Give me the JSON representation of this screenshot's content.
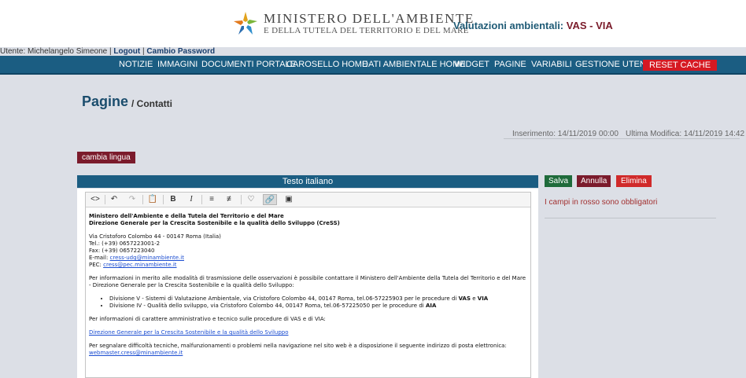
{
  "header": {
    "ministry_title": "MINISTERO DELL'AMBIENTE",
    "ministry_subtitle": "E DELLA TUTELA DEL TERRITORIO E DEL MARE",
    "site_title": "Valutazioni ambientali:",
    "site_title_accent": "VAS - VIA"
  },
  "userbar": {
    "user_text": "Utente: Michelangelo Simeone |",
    "logout": "Logout",
    "separator": "|",
    "change_password": "Cambio Password"
  },
  "nav": {
    "items": [
      "NOTIZIE",
      "IMMAGINI",
      "DOCUMENTI PORTALE",
      "CAROSELLO HOME",
      "DATI AMBIENTALE HOME",
      "WIDGET",
      "PAGINE",
      "VARIABILI",
      "GESTIONE UTENTI"
    ],
    "reset": "RESET CACHE"
  },
  "page": {
    "title": "Pagine",
    "crumb": "/ Contatti",
    "inserted": "Inserimento: 14/11/2019 00:00",
    "modified": "Ultima Modifica: 14/11/2019 14:42",
    "change_language": "cambia lingua",
    "lang_header": "Testo italiano"
  },
  "toolbar": {
    "icons": [
      "code-view-icon",
      "undo-icon",
      "redo-icon",
      "paste-icon",
      "bold-icon",
      "italic-icon",
      "bullet-list-icon",
      "numbered-list-icon",
      "bookmark-icon",
      "link-icon",
      "image-icon"
    ]
  },
  "content": {
    "org1": "Ministero dell'Ambiente e della Tutela del Territorio e del Mare",
    "org2": "Direzione Generale per la Crescita Sostenibile e la qualità dello Sviluppo (CreSS)",
    "address": "Via Cristoforo Colombo 44 - 00147 Roma (Italia)",
    "tel": "Tel.: (+39) 0657223001-2",
    "fax": "Fax: (+39) 0657223040",
    "email_label": "E-mail:",
    "email": "cress-udg@minambiente.it",
    "pec_label": "PEC:",
    "pec": "cress@pec.minambiente.it",
    "info_text": "Per informazioni in merito alle modalità di trasmissione delle osservazioni è possibile contattare il Ministero dell'Ambiente della Tutela del Territorio e del Mare - Direzione Generale per la Crescita Sostenibile e la qualità dello Sviluppo:",
    "div5_text": "Divisione V - Sistemi di Valutazione Ambientale, via Cristoforo Colombo 44, 00147 Roma, tel.06-57225903 per le procedure di",
    "div5_vas": "VAS",
    "div5_and": "e",
    "div5_via": "VIA",
    "div4_text": "Divisione IV - Qualità dello sviluppo, via Cristoforo Colombo 44, 00147 Roma, tel.06-57225050 per le procedure di",
    "div4_aia": "AIA",
    "admin_text": "Per informazioni di carattere amministrativo e tecnico sulle procedure di VAS e di VIA:",
    "dg_link": "Direzione Generale per la Crescita Sostenibile e la qualità dello Sviluppo",
    "tech_text": "Per segnalare difficoltà tecniche, malfunzionamenti o problemi nella navigazione nel sito web è a disposizione il seguente indirizzo di posta elettronica:",
    "webmaster": "webmaster.cress@minambiente.it"
  },
  "actions": {
    "save": "Salva",
    "cancel": "Annulla",
    "delete": "Elimina",
    "required_note": "I campi in rosso sono obbligatori"
  }
}
